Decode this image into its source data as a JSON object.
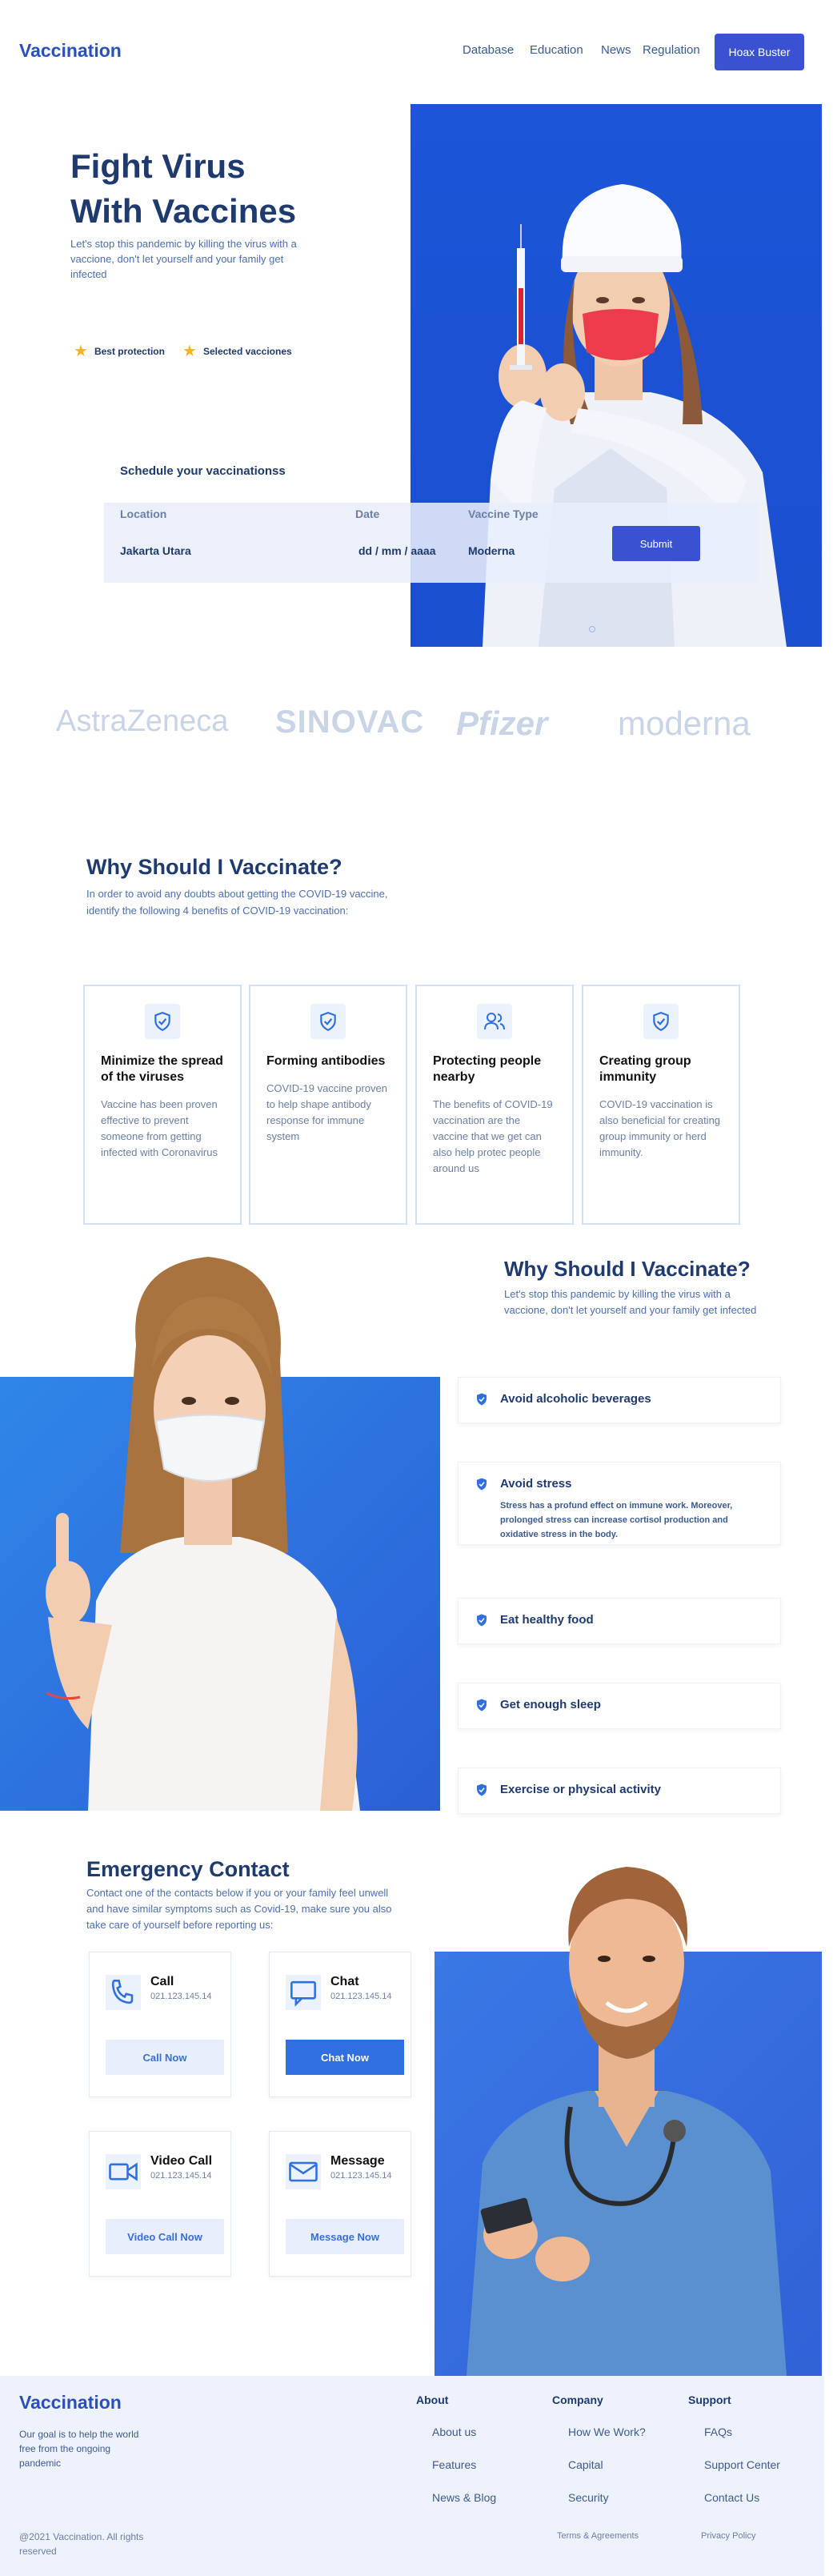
{
  "nav": {
    "logo": "Vaccination",
    "links": [
      "Database",
      "Education",
      "News",
      "Regulation"
    ],
    "cta": "Hoax Buster"
  },
  "hero": {
    "title_line1": "Fight Virus",
    "title_line2": "With Vaccines",
    "subtitle": "Let's stop this pandemic by killing the virus with a vaccione, don't let yourself and your family get infected",
    "badges": [
      "Best protection",
      "Selected vacciones"
    ]
  },
  "schedule": {
    "title": "Schedule your vaccinationss",
    "labels": {
      "location": "Location",
      "date": "Date",
      "vaccine": "Vaccine Type"
    },
    "values": {
      "location": "Jakarta Utara",
      "date": "dd / mm / aaaa",
      "vaccine": "Moderna"
    },
    "submit": "Submit"
  },
  "brands": [
    "AstraZeneca",
    "SINOVAC",
    "Pfizer",
    "moderna"
  ],
  "why": {
    "title": "Why Should I Vaccinate?",
    "subtitle": "In order to avoid any doubts about getting the COVID-19 vaccine, identify the following 4 benefits of COVID-19 vaccination:",
    "cards": [
      {
        "title": "Minimize the spread of the viruses",
        "text": "Vaccine has been proven effective to prevent someone from getting infected with Coronavirus"
      },
      {
        "title": "Forming antibodies",
        "text": "COVID-19 vaccine proven to help shape antibody response for immune system"
      },
      {
        "title": "Protecting people nearby",
        "text": "The benefits of COVID-19 vaccination are the vaccine that we get can also help protec people around us"
      },
      {
        "title": "Creating group immunity",
        "text": "COVID-19 vaccination is also beneficial for creating group immunity or herd immunity."
      }
    ]
  },
  "why2": {
    "title": "Why Should I Vaccinate?",
    "subtitle": "Let's stop this pandemic by killing the virus with a vaccione, don't let yourself and your family get infected",
    "tips": [
      {
        "title": "Avoid alcoholic beverages",
        "desc": ""
      },
      {
        "title": "Avoid stress",
        "desc": "Stress has a profund effect on immune work. Moreover, prolonged stress can increase cortisol production and oxidative stress in the body."
      },
      {
        "title": "Eat healthy food",
        "desc": ""
      },
      {
        "title": "Get enough sleep",
        "desc": ""
      },
      {
        "title": "Exercise or physical activity",
        "desc": ""
      }
    ]
  },
  "emergency": {
    "title": "Emergency Contact",
    "subtitle": "Contact one of the contacts below if you or your family feel unwell and have similar symptoms such as Covid-19, make sure you also take care of yourself before reporting us:",
    "contacts": [
      {
        "name": "Call",
        "number": "021.123.145.14",
        "button": "Call Now",
        "icon": "phone-icon"
      },
      {
        "name": "Chat",
        "number": "021.123.145.14",
        "button": "Chat Now",
        "icon": "chat-icon"
      },
      {
        "name": "Video Call",
        "number": "021.123.145.14",
        "button": "Video Call Now",
        "icon": "video-icon"
      },
      {
        "name": "Message",
        "number": "021.123.145.14",
        "button": "Message Now",
        "icon": "mail-icon"
      }
    ]
  },
  "footer": {
    "logo": "Vaccination",
    "tagline": "Our goal is to help the world free from the ongoing pandemic",
    "copyright": "@2021 Vaccination. All rights reserved",
    "columns": [
      {
        "head": "About",
        "links": [
          "About us",
          "Features",
          "News & Blog"
        ]
      },
      {
        "head": "Company",
        "links": [
          "How We Work?",
          "Capital",
          "Security"
        ]
      },
      {
        "head": "Support",
        "links": [
          "FAQs",
          "Support Center",
          "Contact Us"
        ]
      }
    ],
    "bottom_links": [
      "Terms & Agreements",
      "Privacy Policy"
    ]
  },
  "colors": {
    "primary": "#3a52d0",
    "navy": "#1e3a6e",
    "hero_blue": "#1c55d8",
    "accent_blue": "#2f6fe0"
  }
}
